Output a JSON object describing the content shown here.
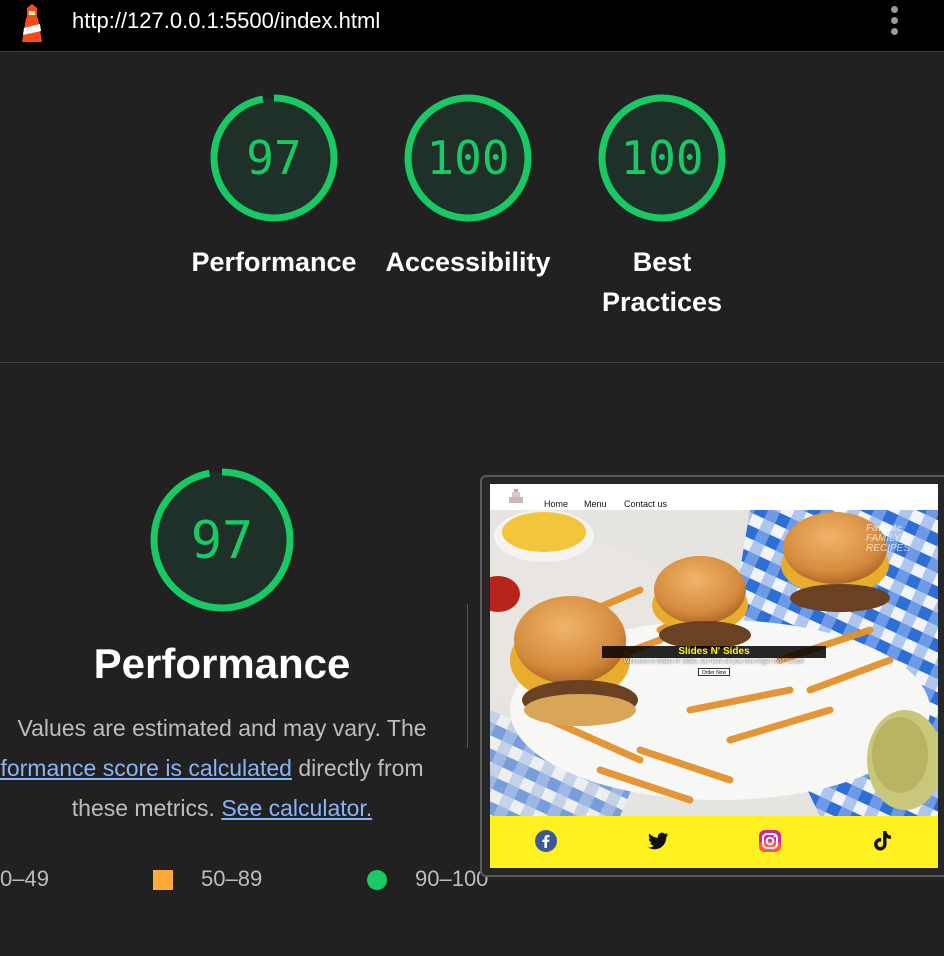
{
  "browser": {
    "url": "http://127.0.0.1:5500/index.html",
    "app_icon": "lighthouse-icon",
    "menu_icon": "more-vert-icon"
  },
  "scores": [
    {
      "label": "Performance",
      "value": 97
    },
    {
      "label": "Accessibility",
      "value": 100
    },
    {
      "label": "Best Practices",
      "value": 100
    }
  ],
  "performance_section": {
    "score": 97,
    "title": "Performance",
    "description_prefix": "Values are estimated and may vary. The",
    "score_link": "erformance score is calculated",
    "description_middle": "directly from",
    "description_line3": "these metrics.",
    "calculator_link": "See calculator."
  },
  "legend": [
    {
      "range": "0–49",
      "color": "#ff4e42"
    },
    {
      "range": "50–89",
      "color": "#ffa93a"
    },
    {
      "range": "90–100",
      "color": "#18c964"
    }
  ],
  "colors": {
    "pass": "#18c964",
    "background": "#212121",
    "link": "#8ab4f8"
  },
  "screenshot": {
    "nav_links": [
      "Home",
      "Menu",
      "Contact us"
    ],
    "banner_title": "Slides N' Sides",
    "welcome_text": "Welcome to Slides N' Sides, we have all you mini finger food needs!",
    "order_button": "Order Now",
    "watermark": "Favorite FAMILY RECIPES",
    "social_icons": [
      "facebook-icon",
      "twitter-icon",
      "instagram-icon",
      "tiktok-icon"
    ],
    "footer_color": "#fff11f"
  }
}
